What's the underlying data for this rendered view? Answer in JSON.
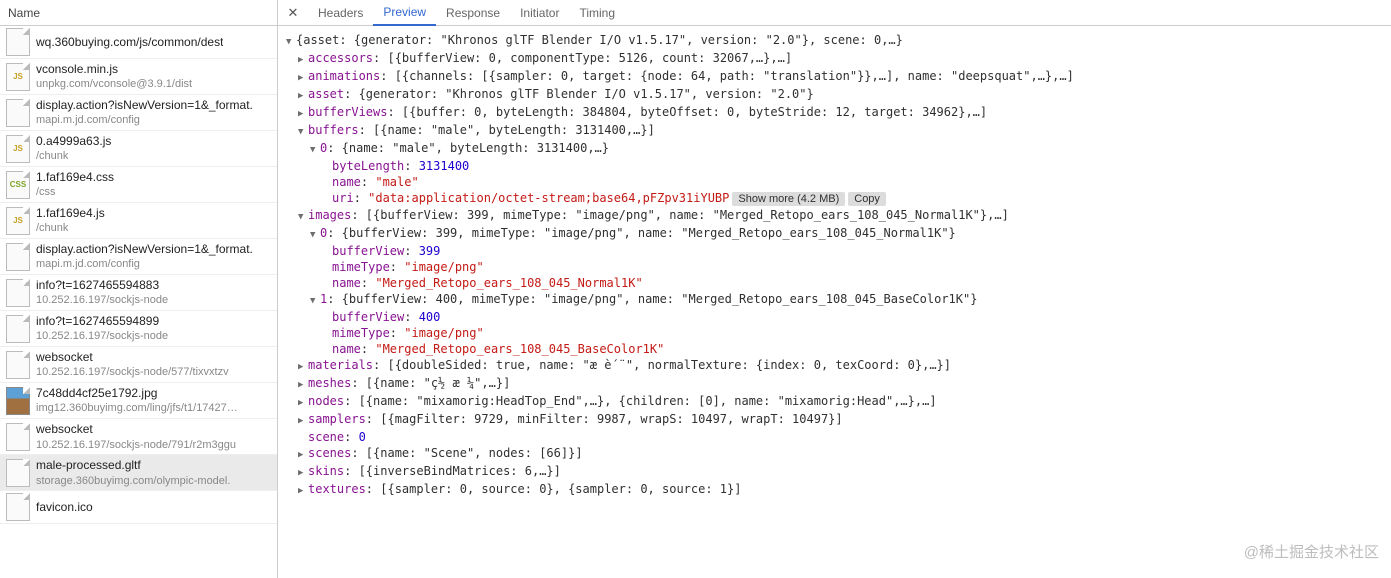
{
  "sidebar": {
    "header": "Name",
    "files": [
      {
        "icon": "plain",
        "name": "wq.360buying.com/js/common/dest",
        "sub": ""
      },
      {
        "icon": "js",
        "name": "vconsole.min.js",
        "sub": "unpkg.com/vconsole@3.9.1/dist"
      },
      {
        "icon": "plain",
        "name": "display.action?isNewVersion=1&_format.",
        "sub": "mapi.m.jd.com/config"
      },
      {
        "icon": "js",
        "name": "0.a4999a63.js",
        "sub": "/chunk"
      },
      {
        "icon": "css",
        "name": "1.faf169e4.css",
        "sub": "/css"
      },
      {
        "icon": "js",
        "name": "1.faf169e4.js",
        "sub": "/chunk"
      },
      {
        "icon": "plain",
        "name": "display.action?isNewVersion=1&_format.",
        "sub": "mapi.m.jd.com/config"
      },
      {
        "icon": "plain",
        "name": "info?t=1627465594883",
        "sub": "10.252.16.197/sockjs-node"
      },
      {
        "icon": "plain",
        "name": "info?t=1627465594899",
        "sub": "10.252.16.197/sockjs-node"
      },
      {
        "icon": "plain",
        "name": "websocket",
        "sub": "10.252.16.197/sockjs-node/577/tixvxtzv"
      },
      {
        "icon": "img",
        "name": "7c48dd4cf25e1792.jpg",
        "sub": "img12.360buyimg.com/ling/jfs/t1/17427…"
      },
      {
        "icon": "plain",
        "name": "websocket",
        "sub": "10.252.16.197/sockjs-node/791/r2m3ggu"
      },
      {
        "icon": "plain",
        "name": "male-processed.gltf",
        "sub": "storage.360buyimg.com/olympic-model.",
        "selected": true
      },
      {
        "icon": "plain",
        "name": "favicon.ico",
        "sub": ""
      }
    ]
  },
  "tabs": {
    "items": [
      "Headers",
      "Preview",
      "Response",
      "Initiator",
      "Timing"
    ],
    "active": "Preview"
  },
  "tree": [
    {
      "indent": 0,
      "arrow": "down",
      "raw": [
        [
          "plain",
          "{asset: {generator: \"Khronos glTF Blender I/O v1.5.17\", version: \"2.0\"}, scene: 0,…}"
        ]
      ]
    },
    {
      "indent": 1,
      "arrow": "right",
      "raw": [
        [
          "prop",
          "accessors"
        ],
        [
          "plain",
          ": [{bufferView: 0, componentType: 5126, count: 32067,…},…]"
        ]
      ]
    },
    {
      "indent": 1,
      "arrow": "right",
      "raw": [
        [
          "prop",
          "animations"
        ],
        [
          "plain",
          ": [{channels: [{sampler: 0, target: {node: 64, path: \"translation\"}},…], name: \"deepsquat\",…},…]"
        ]
      ]
    },
    {
      "indent": 1,
      "arrow": "right",
      "raw": [
        [
          "prop",
          "asset"
        ],
        [
          "plain",
          ": {generator: \"Khronos glTF Blender I/O v1.5.17\", version: \"2.0\"}"
        ]
      ]
    },
    {
      "indent": 1,
      "arrow": "right",
      "raw": [
        [
          "prop",
          "bufferViews"
        ],
        [
          "plain",
          ": [{buffer: 0, byteLength: 384804, byteOffset: 0, byteStride: 12, target: 34962},…]"
        ]
      ]
    },
    {
      "indent": 1,
      "arrow": "down",
      "raw": [
        [
          "prop",
          "buffers"
        ],
        [
          "plain",
          ": [{name: \"male\", byteLength: 3131400,…}]"
        ]
      ]
    },
    {
      "indent": 2,
      "arrow": "down",
      "raw": [
        [
          "prop",
          "0"
        ],
        [
          "plain",
          ": {name: \"male\", byteLength: 3131400,…}"
        ]
      ]
    },
    {
      "indent": 3,
      "arrow": "none",
      "raw": [
        [
          "prop",
          "byteLength"
        ],
        [
          "plain",
          ": "
        ],
        [
          "num",
          "3131400"
        ]
      ]
    },
    {
      "indent": 3,
      "arrow": "none",
      "raw": [
        [
          "prop",
          "name"
        ],
        [
          "plain",
          ": "
        ],
        [
          "str",
          "\"male\""
        ]
      ]
    },
    {
      "indent": 3,
      "arrow": "none",
      "raw": [
        [
          "prop",
          "uri"
        ],
        [
          "plain",
          ": "
        ],
        [
          "str",
          "\"data:application/octet-stream;base64,pFZpv31iYUBP"
        ]
      ],
      "btns": [
        "Show more (4.2 MB)",
        "Copy"
      ]
    },
    {
      "indent": 1,
      "arrow": "down",
      "raw": [
        [
          "prop",
          "images"
        ],
        [
          "plain",
          ": [{bufferView: 399, mimeType: \"image/png\", name: \"Merged_Retopo_ears_108_045_Normal1K\"},…]"
        ]
      ]
    },
    {
      "indent": 2,
      "arrow": "down",
      "raw": [
        [
          "prop",
          "0"
        ],
        [
          "plain",
          ": {bufferView: 399, mimeType: \"image/png\", name: \"Merged_Retopo_ears_108_045_Normal1K\"}"
        ]
      ]
    },
    {
      "indent": 3,
      "arrow": "none",
      "raw": [
        [
          "prop",
          "bufferView"
        ],
        [
          "plain",
          ": "
        ],
        [
          "num",
          "399"
        ]
      ]
    },
    {
      "indent": 3,
      "arrow": "none",
      "raw": [
        [
          "prop",
          "mimeType"
        ],
        [
          "plain",
          ": "
        ],
        [
          "str",
          "\"image/png\""
        ]
      ]
    },
    {
      "indent": 3,
      "arrow": "none",
      "raw": [
        [
          "prop",
          "name"
        ],
        [
          "plain",
          ": "
        ],
        [
          "str",
          "\"Merged_Retopo_ears_108_045_Normal1K\""
        ]
      ]
    },
    {
      "indent": 2,
      "arrow": "down",
      "raw": [
        [
          "prop",
          "1"
        ],
        [
          "plain",
          ": {bufferView: 400, mimeType: \"image/png\", name: \"Merged_Retopo_ears_108_045_BaseColor1K\"}"
        ]
      ]
    },
    {
      "indent": 3,
      "arrow": "none",
      "raw": [
        [
          "prop",
          "bufferView"
        ],
        [
          "plain",
          ": "
        ],
        [
          "num",
          "400"
        ]
      ]
    },
    {
      "indent": 3,
      "arrow": "none",
      "raw": [
        [
          "prop",
          "mimeType"
        ],
        [
          "plain",
          ": "
        ],
        [
          "str",
          "\"image/png\""
        ]
      ]
    },
    {
      "indent": 3,
      "arrow": "none",
      "raw": [
        [
          "prop",
          "name"
        ],
        [
          "plain",
          ": "
        ],
        [
          "str",
          "\"Merged_Retopo_ears_108_045_BaseColor1K\""
        ]
      ]
    },
    {
      "indent": 1,
      "arrow": "right",
      "raw": [
        [
          "prop",
          "materials"
        ],
        [
          "plain",
          ": [{doubleSided: true, name: \"æ  è´¨\", normalTexture: {index: 0, texCoord: 0},…}]"
        ]
      ]
    },
    {
      "indent": 1,
      "arrow": "right",
      "raw": [
        [
          "prop",
          "meshes"
        ],
        [
          "plain",
          ": [{name: \"ç½ æ ¼\",…}]"
        ]
      ]
    },
    {
      "indent": 1,
      "arrow": "right",
      "raw": [
        [
          "prop",
          "nodes"
        ],
        [
          "plain",
          ": [{name: \"mixamorig:HeadTop_End\",…}, {children: [0], name: \"mixamorig:Head\",…},…]"
        ]
      ]
    },
    {
      "indent": 1,
      "arrow": "right",
      "raw": [
        [
          "prop",
          "samplers"
        ],
        [
          "plain",
          ": [{magFilter: 9729, minFilter: 9987, wrapS: 10497, wrapT: 10497}]"
        ]
      ]
    },
    {
      "indent": 1,
      "arrow": "none",
      "raw": [
        [
          "prop",
          "scene"
        ],
        [
          "plain",
          ": "
        ],
        [
          "num",
          "0"
        ]
      ]
    },
    {
      "indent": 1,
      "arrow": "right",
      "raw": [
        [
          "prop",
          "scenes"
        ],
        [
          "plain",
          ": [{name: \"Scene\", nodes: [66]}]"
        ]
      ]
    },
    {
      "indent": 1,
      "arrow": "right",
      "raw": [
        [
          "prop",
          "skins"
        ],
        [
          "plain",
          ": [{inverseBindMatrices: 6,…}]"
        ]
      ]
    },
    {
      "indent": 1,
      "arrow": "right",
      "raw": [
        [
          "prop",
          "textures"
        ],
        [
          "plain",
          ": [{sampler: 0, source: 0}, {sampler: 0, source: 1}]"
        ]
      ]
    }
  ],
  "watermark": "@稀土掘金技术社区"
}
